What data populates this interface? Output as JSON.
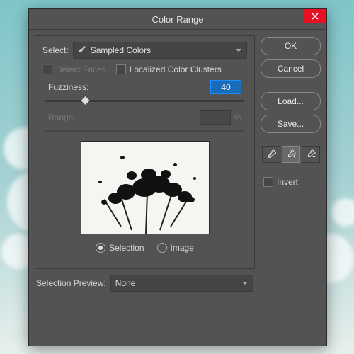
{
  "title": "Color Range",
  "select_label": "Select:",
  "select_value": "Sampled Colors",
  "detect_faces": "Detect Faces",
  "localized": "Localized Color Clusters",
  "fuzziness_label": "Fuzziness:",
  "fuzziness_value": "40",
  "range_label": "Range:",
  "percent": "%",
  "radio_selection": "Selection",
  "radio_image": "Image",
  "selection_preview_label": "Selection Preview:",
  "selection_preview_value": "None",
  "buttons": {
    "ok": "OK",
    "cancel": "Cancel",
    "load": "Load...",
    "save": "Save..."
  },
  "invert": "Invert"
}
